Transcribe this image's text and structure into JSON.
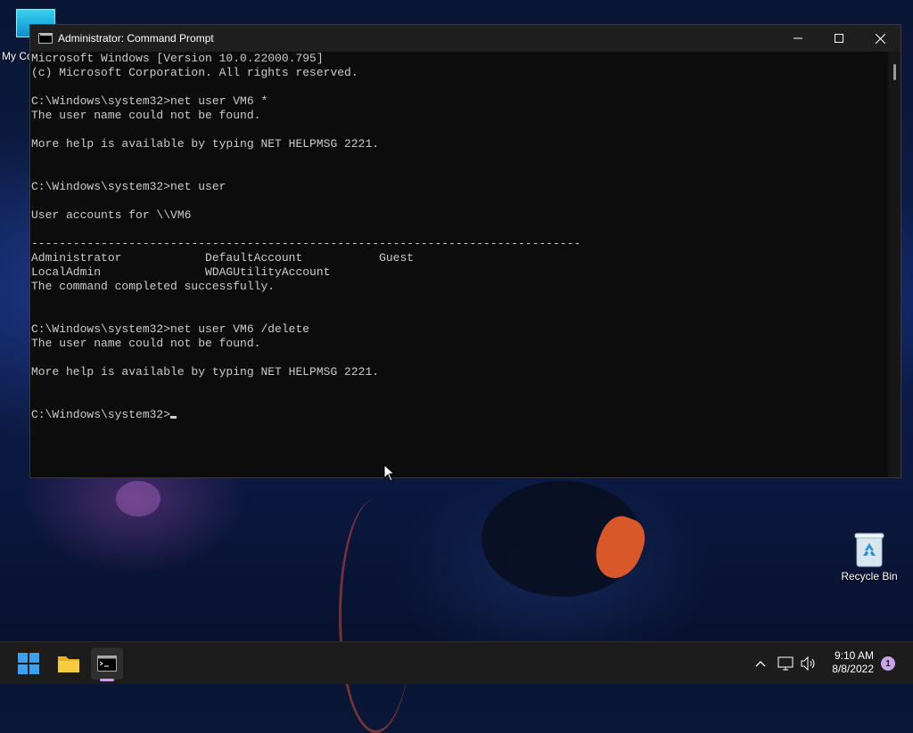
{
  "desktop": {
    "icons": [
      {
        "label": "My Co",
        "icon": "computer-icon"
      },
      {
        "label": "Recycle Bin",
        "icon": "recycle-bin-icon"
      }
    ]
  },
  "window": {
    "title": "Administrator: Command Prompt",
    "controls": [
      "minimize",
      "maximize",
      "close"
    ]
  },
  "console": {
    "lines": [
      "Microsoft Windows [Version 10.0.22000.795]",
      "(c) Microsoft Corporation. All rights reserved.",
      "",
      "C:\\Windows\\system32>net user VM6 *",
      "The user name could not be found.",
      "",
      "More help is available by typing NET HELPMSG 2221.",
      "",
      "",
      "C:\\Windows\\system32>net user",
      "",
      "User accounts for \\\\VM6",
      "",
      "-------------------------------------------------------------------------------",
      "Administrator            DefaultAccount           Guest",
      "LocalAdmin               WDAGUtilityAccount",
      "The command completed successfully.",
      "",
      "",
      "C:\\Windows\\system32>net user VM6 /delete",
      "The user name could not be found.",
      "",
      "More help is available by typing NET HELPMSG 2221.",
      "",
      "",
      "C:\\Windows\\system32>"
    ]
  },
  "taskbar": {
    "items": [
      "start-icon",
      "file-explorer-icon",
      "command-prompt-icon"
    ],
    "tray": [
      "chevron-up-icon",
      "network-icon",
      "volume-icon"
    ],
    "time": "9:10 AM",
    "date": "8/8/2022",
    "notification_count": "1"
  }
}
